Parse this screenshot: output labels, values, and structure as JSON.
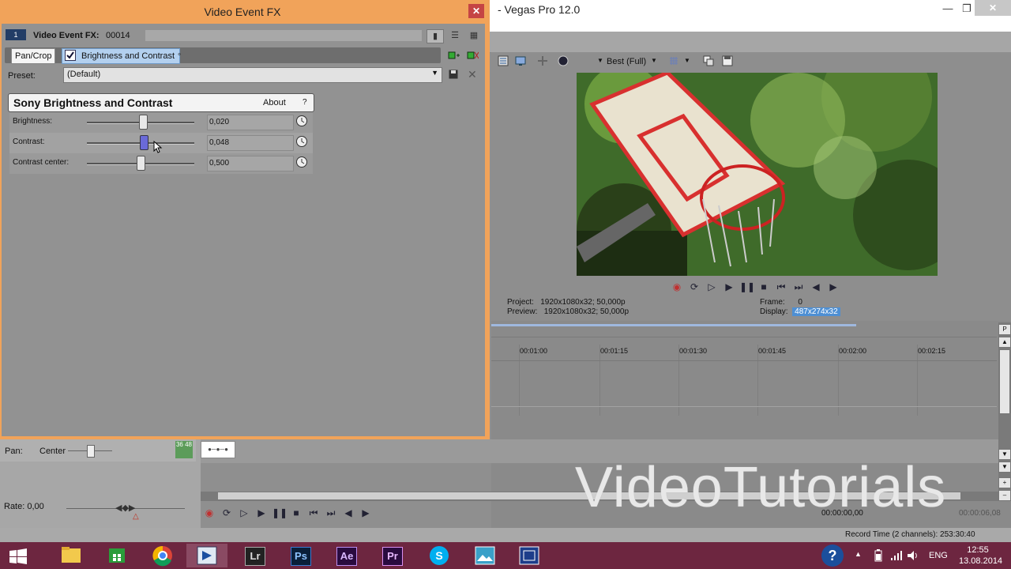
{
  "main_window": {
    "title": "- Vegas Pro 12.0"
  },
  "fx_dialog": {
    "title": "Video Event FX",
    "chain_label": "Video Event FX:",
    "chain_id": "00014",
    "chain_index": "1",
    "plugins": [
      {
        "label": "Pan/Crop"
      },
      {
        "label": "Brightness and Contrast"
      }
    ],
    "preset_label": "Preset:",
    "preset_value": "(Default)",
    "plugin_name": "Sony Brightness and Contrast",
    "about_label": "About",
    "help_label": "?",
    "params": [
      {
        "label": "Brightness:",
        "value": "0,020",
        "fraction": 0.52
      },
      {
        "label": "Contrast:",
        "value": "0,048",
        "fraction": 0.53
      },
      {
        "label": "Contrast center:",
        "value": "0,500",
        "fraction": 0.5
      }
    ]
  },
  "preview": {
    "quality": "Best (Full)",
    "project_label": "Project:",
    "project_value": "1920x1080x32; 50,000p",
    "preview_label": "Preview:",
    "preview_value": "1920x1080x32; 50,000p",
    "frame_label": "Frame:",
    "frame_value": "0",
    "display_label": "Display:",
    "display_value": "487x274x32"
  },
  "timeline": {
    "ticks": [
      "00:01:00",
      "00:01:15",
      "00:01:30",
      "00:01:45",
      "00:02:00",
      "00:02:15"
    ],
    "time_readout": "00:00:00,00",
    "time_readout_end": "00:00:06,08",
    "record_time": "Record Time (2 channels): 253:30:40"
  },
  "track": {
    "pan_label": "Pan:",
    "pan_value": "Center",
    "track_counter": "36 48",
    "rate_label": "Rate: 0,00"
  },
  "watermark": "VideoTutorials",
  "taskbar": {
    "apps": [
      "windows-start",
      "file-explorer",
      "store",
      "chrome",
      "vegas",
      "lightroom",
      "photoshop",
      "after-effects",
      "premiere",
      "skype",
      "photo-viewer",
      "vegas-alt"
    ],
    "lr_label": "Lr",
    "ps_label": "Ps",
    "ae_label": "Ae",
    "pr_label": "Pr",
    "lang": "ENG",
    "time": "12:55",
    "date": "13.08.2014"
  },
  "colors": {
    "dialog_frame": "#f1a35a",
    "taskbar": "#6d2640",
    "selected_plugin": "#b3d0ef",
    "display_highlight": "#4e8fd3"
  }
}
